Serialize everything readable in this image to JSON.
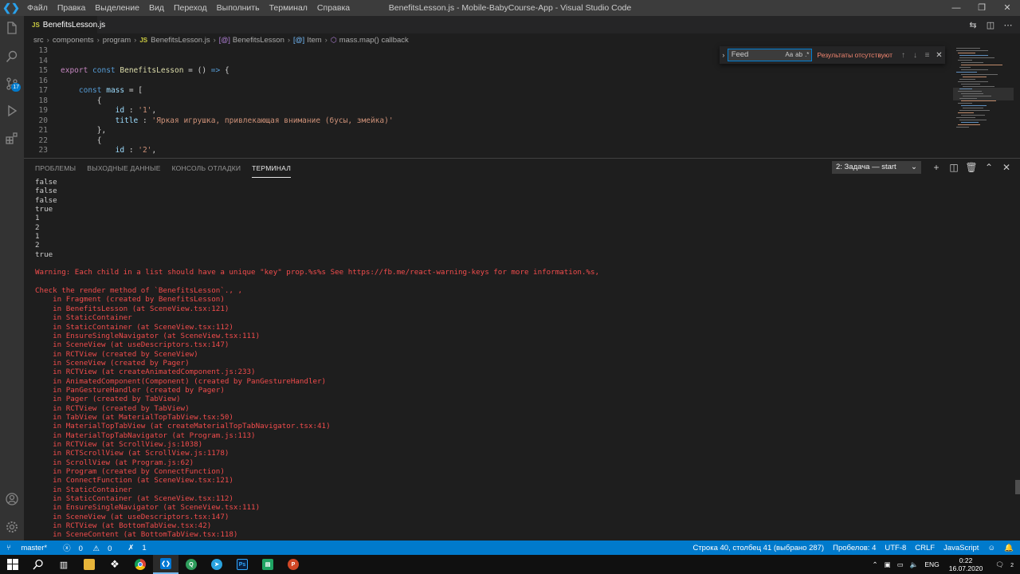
{
  "window": {
    "title": "BenefitsLesson.js - Mobile-BabyCourse-App - Visual Studio Code",
    "menu": [
      "Файл",
      "Правка",
      "Выделение",
      "Вид",
      "Переход",
      "Выполнить",
      "Терминал",
      "Справка"
    ]
  },
  "activity": {
    "scm_badge": "17"
  },
  "tab": {
    "prefix": "JS",
    "label": "BenefitsLesson.js"
  },
  "breadcrumb": [
    "src",
    "components",
    "program",
    "BenefitsLesson.js",
    "BenefitsLesson",
    "Item",
    "mass.map() callback"
  ],
  "editor": {
    "lines": [
      {
        "n": "13",
        "tokens": []
      },
      {
        "n": "14",
        "tokens": []
      },
      {
        "n": "15",
        "tokens": [
          [
            "kw2",
            "export "
          ],
          [
            "kw",
            "const "
          ],
          [
            "fn",
            "BenefitsLesson"
          ],
          [
            "pl",
            " = () "
          ],
          [
            "kw",
            "=>"
          ],
          [
            "pl",
            " {"
          ]
        ]
      },
      {
        "n": "16",
        "tokens": []
      },
      {
        "n": "17",
        "tokens": [
          [
            "pl",
            "    "
          ],
          [
            "kw",
            "const "
          ],
          [
            "var",
            "mass"
          ],
          [
            "pl",
            " = ["
          ]
        ]
      },
      {
        "n": "18",
        "tokens": [
          [
            "pl",
            "        {"
          ]
        ]
      },
      {
        "n": "19",
        "tokens": [
          [
            "pl",
            "            "
          ],
          [
            "var",
            "id"
          ],
          [
            "pl",
            " : "
          ],
          [
            "str",
            "'1'"
          ],
          [
            "pl",
            ","
          ]
        ]
      },
      {
        "n": "20",
        "tokens": [
          [
            "pl",
            "            "
          ],
          [
            "var",
            "title"
          ],
          [
            "pl",
            " : "
          ],
          [
            "str",
            "'Яркая игрушка, привлекающая внимание (бусы, змейка)'"
          ]
        ]
      },
      {
        "n": "21",
        "tokens": [
          [
            "pl",
            "        },"
          ]
        ]
      },
      {
        "n": "22",
        "tokens": [
          [
            "pl",
            "        {"
          ]
        ]
      },
      {
        "n": "23",
        "tokens": [
          [
            "pl",
            "            "
          ],
          [
            "var",
            "id"
          ],
          [
            "pl",
            " : "
          ],
          [
            "str",
            "'2'"
          ],
          [
            "pl",
            ","
          ]
        ]
      }
    ]
  },
  "find": {
    "value": "Feed",
    "opt_case": "Aa",
    "opt_word": "ab",
    "opt_regex": ".*",
    "result": "Результаты отсутствуют"
  },
  "panel": {
    "tabs": [
      "ПРОБЛЕМЫ",
      "ВЫХОДНЫЕ ДАННЫЕ",
      "КОНСОЛЬ ОТЛАДКИ",
      "ТЕРМИНАЛ"
    ],
    "task": "2: Задача — start"
  },
  "terminal": {
    "output": [
      "false",
      "false",
      "false",
      "true",
      "1",
      "2",
      "1",
      "2",
      "true",
      ""
    ],
    "errors": [
      "Warning: Each child in a list should have a unique \"key\" prop.%s%s See https://fb.me/react-warning-keys for more information.%s,",
      "",
      "Check the render method of `BenefitsLesson`., ,",
      "    in Fragment (created by BenefitsLesson)",
      "    in BenefitsLesson (at SceneView.tsx:121)",
      "    in StaticContainer",
      "    in StaticContainer (at SceneView.tsx:112)",
      "    in EnsureSingleNavigator (at SceneView.tsx:111)",
      "    in SceneView (at useDescriptors.tsx:147)",
      "    in RCTView (created by SceneView)",
      "    in SceneView (created by Pager)",
      "    in RCTView (at createAnimatedComponent.js:233)",
      "    in AnimatedComponent(Component) (created by PanGestureHandler)",
      "    in PanGestureHandler (created by Pager)",
      "    in Pager (created by TabView)",
      "    in RCTView (created by TabView)",
      "    in TabView (at MaterialTopTabView.tsx:50)",
      "    in MaterialTopTabView (at createMaterialTopTabNavigator.tsx:41)",
      "    in MaterialTopTabNavigator (at Program.js:113)",
      "    in RCTView (at ScrollView.js:1038)",
      "    in RCTScrollView (at ScrollView.js:1178)",
      "    in ScrollView (at Program.js:62)",
      "    in Program (created by ConnectFunction)",
      "    in ConnectFunction (at SceneView.tsx:121)",
      "    in StaticContainer",
      "    in StaticContainer (at SceneView.tsx:112)",
      "    in EnsureSingleNavigator (at SceneView.tsx:111)",
      "    in SceneView (at useDescriptors.tsx:147)",
      "    in RCTView (at BottomTabView.tsx:42)",
      "    in SceneContent (at BottomTabView.tsx:118)"
    ]
  },
  "statusbar": {
    "branch": "master*",
    "errors": "0",
    "warnings": "0",
    "ports": "1",
    "position": "Строка 40, столбец 41 (выбрано 287)",
    "indent": "Пробелов: 4",
    "encoding": "UTF-8",
    "eol": "CRLF",
    "language": "JavaScript"
  },
  "taskbar": {
    "lang": "ENG",
    "time": "0:22",
    "date": "16.07.2020",
    "notifications": "2"
  }
}
